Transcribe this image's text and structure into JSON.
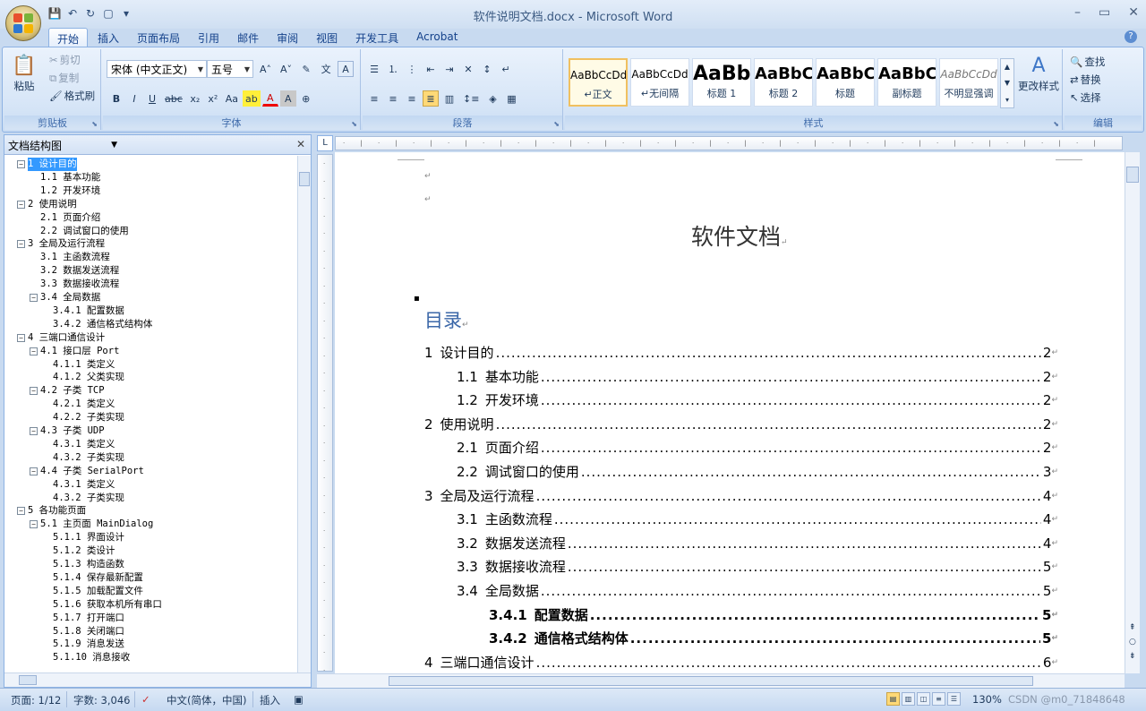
{
  "window": {
    "title": "软件说明文档.docx - Microsoft Word"
  },
  "tabs": [
    "开始",
    "插入",
    "页面布局",
    "引用",
    "邮件",
    "审阅",
    "视图",
    "开发工具",
    "Acrobat"
  ],
  "ribbon": {
    "clipboard": {
      "label": "剪贴板",
      "paste": "粘贴",
      "cut": "剪切",
      "copy": "复制",
      "format_painter": "格式刷"
    },
    "font": {
      "label": "字体",
      "font_name": "宋体 (中文正文)",
      "font_size": "五号"
    },
    "paragraph": {
      "label": "段落"
    },
    "styles": {
      "label": "样式",
      "change_styles": "更改样式",
      "items": [
        {
          "sample": "AaBbCcDd",
          "name": "↵正文"
        },
        {
          "sample": "AaBbCcDd",
          "name": "↵无间隔"
        },
        {
          "sample": "AaBb",
          "name": "标题 1"
        },
        {
          "sample": "AaBbC",
          "name": "标题 2"
        },
        {
          "sample": "AaBbC",
          "name": "标题"
        },
        {
          "sample": "AaBbC",
          "name": "副标题"
        },
        {
          "sample": "AaBbCcDd",
          "name": "不明显强调"
        }
      ]
    },
    "editing": {
      "label": "编辑",
      "find": "查找",
      "replace": "替换",
      "select": "选择"
    }
  },
  "navpane": {
    "mode": "文档结构图",
    "items": [
      {
        "text": "1 设计目的",
        "level": 0,
        "box": "−",
        "hl": true
      },
      {
        "text": "1.1 基本功能",
        "level": 1
      },
      {
        "text": "1.2 开发环境",
        "level": 1
      },
      {
        "text": "2 使用说明",
        "level": 0,
        "box": "−"
      },
      {
        "text": "2.1 页面介绍",
        "level": 1
      },
      {
        "text": "2.2 调试窗口的使用",
        "level": 1
      },
      {
        "text": "3 全局及运行流程",
        "level": 0,
        "box": "−"
      },
      {
        "text": "3.1 主函数流程",
        "level": 1
      },
      {
        "text": "3.2 数据发送流程",
        "level": 1
      },
      {
        "text": "3.3 数据接收流程",
        "level": 1
      },
      {
        "text": "3.4 全局数据",
        "level": 1,
        "box": "−"
      },
      {
        "text": "3.4.1 配置数据",
        "level": 2
      },
      {
        "text": "3.4.2 通信格式结构体",
        "level": 2
      },
      {
        "text": "4 三端口通信设计",
        "level": 0,
        "box": "−"
      },
      {
        "text": "4.1 接口层 Port",
        "level": 1,
        "box": "−"
      },
      {
        "text": "4.1.1 类定义",
        "level": 2
      },
      {
        "text": "4.1.2 父类实现",
        "level": 2
      },
      {
        "text": "4.2 子类 TCP",
        "level": 1,
        "box": "−"
      },
      {
        "text": "4.2.1 类定义",
        "level": 2
      },
      {
        "text": "4.2.2 子类实现",
        "level": 2
      },
      {
        "text": "4.3 子类 UDP",
        "level": 1,
        "box": "−"
      },
      {
        "text": "4.3.1 类定义",
        "level": 2
      },
      {
        "text": "4.3.2 子类实现",
        "level": 2
      },
      {
        "text": "4.4 子类 SerialPort",
        "level": 1,
        "box": "−"
      },
      {
        "text": "4.3.1 类定义",
        "level": 2
      },
      {
        "text": "4.3.2 子类实现",
        "level": 2
      },
      {
        "text": "5 各功能页面",
        "level": 0,
        "box": "−"
      },
      {
        "text": "5.1 主页面 MainDialog",
        "level": 1,
        "box": "−"
      },
      {
        "text": "5.1.1 界面设计",
        "level": 2
      },
      {
        "text": "5.1.2 类设计",
        "level": 2
      },
      {
        "text": "5.1.3 构造函数",
        "level": 2
      },
      {
        "text": "5.1.4 保存最新配置",
        "level": 2
      },
      {
        "text": "5.1.5 加载配置文件",
        "level": 2
      },
      {
        "text": "5.1.6 获取本机所有串口",
        "level": 2
      },
      {
        "text": "5.1.7 打开端口",
        "level": 2
      },
      {
        "text": "5.1.8 关闭端口",
        "level": 2
      },
      {
        "text": "5.1.9 消息发送",
        "level": 2
      },
      {
        "text": "5.1.10 消息接收",
        "level": 2
      }
    ]
  },
  "document": {
    "title": "软件文档",
    "toc_heading": "目录",
    "toc": [
      {
        "num": "1",
        "text": "设计目的",
        "page": "2",
        "level": 1
      },
      {
        "num": "1.1",
        "text": "基本功能",
        "page": "2",
        "level": 2
      },
      {
        "num": "1.2",
        "text": "开发环境",
        "page": "2",
        "level": 2
      },
      {
        "num": "2",
        "text": "使用说明",
        "page": "2",
        "level": 1
      },
      {
        "num": "2.1",
        "text": "页面介绍",
        "page": "2",
        "level": 2
      },
      {
        "num": "2.2",
        "text": "调试窗口的使用",
        "page": "3",
        "level": 2
      },
      {
        "num": "3",
        "text": "全局及运行流程",
        "page": "4",
        "level": 1
      },
      {
        "num": "3.1",
        "text": "主函数流程",
        "page": "4",
        "level": 2
      },
      {
        "num": "3.2",
        "text": "数据发送流程",
        "page": "4",
        "level": 2
      },
      {
        "num": "3.3",
        "text": "数据接收流程",
        "page": "5",
        "level": 2
      },
      {
        "num": "3.4",
        "text": "全局数据",
        "page": "5",
        "level": 2
      },
      {
        "num": "3.4.1",
        "text": "配置数据",
        "page": "5",
        "level": 3
      },
      {
        "num": "3.4.2",
        "text": "通信格式结构体",
        "page": "5",
        "level": 3
      },
      {
        "num": "4",
        "text": "三端口通信设计",
        "page": "6",
        "level": 1
      }
    ]
  },
  "status": {
    "page": "页面: 1/12",
    "words": "字数: 3,046",
    "language": "中文(简体，中国)",
    "mode": "插入",
    "zoom": "130%",
    "watermark": "CSDN @m0_71848648"
  }
}
